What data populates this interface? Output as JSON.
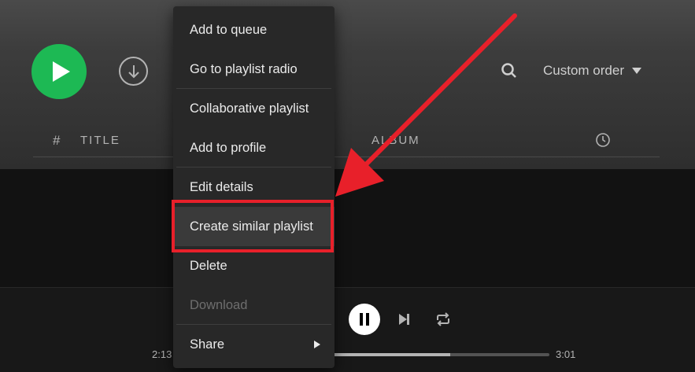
{
  "playlist_controls": {
    "sort_label": "Custom order",
    "play_icon": "play-icon",
    "download_icon": "download-circle-icon",
    "search_icon": "search-icon",
    "dropdown_icon": "caret-down-icon"
  },
  "track_list_header": {
    "number_label": "#",
    "title_label": "TITLE",
    "album_label": "ALBUM",
    "duration_icon": "clock-icon"
  },
  "context_menu": {
    "items": [
      {
        "label": "Add to queue"
      },
      {
        "label": "Go to playlist radio"
      },
      {
        "label": "Collaborative playlist"
      },
      {
        "label": "Add to profile"
      },
      {
        "label": "Edit details"
      },
      {
        "label": "Create similar playlist"
      },
      {
        "label": "Delete"
      },
      {
        "label": "Download"
      },
      {
        "label": "Share"
      }
    ],
    "highlighted_item": "Create similar playlist",
    "disabled_item": "Download"
  },
  "player": {
    "elapsed": "2:13",
    "duration": "3:01",
    "progress": 0.735,
    "pause_icon": "pause-icon",
    "next_icon": "skip-next-icon",
    "repeat_icon": "repeat-icon"
  },
  "colors": {
    "accent_green": "#1db954",
    "annotation_red": "#e8202a",
    "menu_background": "#282828"
  }
}
